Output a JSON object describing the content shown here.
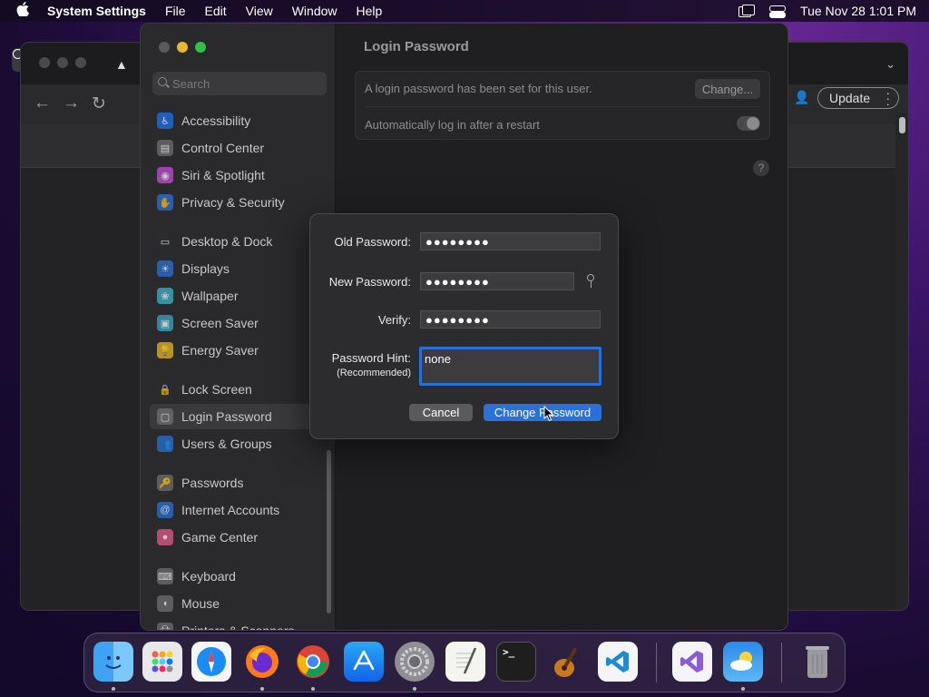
{
  "menubar": {
    "app_name": "System Settings",
    "menus": [
      "File",
      "Edit",
      "View",
      "Window",
      "Help"
    ],
    "clock": "Tue Nov 28  1:01 PM"
  },
  "browser": {
    "update_label": "Update"
  },
  "settings": {
    "search_placeholder": "Search",
    "page_title": "Login Password",
    "password_set_text": "A login password has been set for this user.",
    "change_label": "Change...",
    "auto_login_text": "Automatically log in after a restart",
    "help_label": "?",
    "sidebar_items": [
      {
        "label": "Accessibility",
        "icon": "accessibility-icon",
        "color": "#1a73e8"
      },
      {
        "label": "Control Center",
        "icon": "control-center-icon",
        "color": "#6e6e70"
      },
      {
        "label": "Siri & Spotlight",
        "icon": "siri-icon",
        "color": "#c64bd6"
      },
      {
        "label": "Privacy & Security",
        "icon": "hand-icon",
        "color": "#2a6fd6"
      },
      {
        "label": "Desktop & Dock",
        "icon": "desktop-icon",
        "color": "#2c2c2e"
      },
      {
        "label": "Displays",
        "icon": "displays-icon",
        "color": "#2a6fd6"
      },
      {
        "label": "Wallpaper",
        "icon": "wallpaper-icon",
        "color": "#3bb5c8"
      },
      {
        "label": "Screen Saver",
        "icon": "screen-saver-icon",
        "color": "#3aa7c0"
      },
      {
        "label": "Energy Saver",
        "icon": "energy-icon",
        "color": "#e8b320"
      },
      {
        "label": "Lock Screen",
        "icon": "lock-icon",
        "color": "#2c2c2e"
      },
      {
        "label": "Login Password",
        "icon": "login-password-icon",
        "color": "#6e6e70"
      },
      {
        "label": "Users & Groups",
        "icon": "users-icon",
        "color": "#2a6fd6"
      },
      {
        "label": "Passwords",
        "icon": "key-icon",
        "color": "#6e6e70"
      },
      {
        "label": "Internet Accounts",
        "icon": "at-icon",
        "color": "#2a6fd6"
      },
      {
        "label": "Game Center",
        "icon": "game-center-icon",
        "color": "#e05a8a"
      },
      {
        "label": "Keyboard",
        "icon": "keyboard-icon",
        "color": "#6e6e70"
      },
      {
        "label": "Mouse",
        "icon": "mouse-icon",
        "color": "#6e6e70"
      },
      {
        "label": "Printers & Scanners",
        "icon": "printer-icon",
        "color": "#6e6e70"
      }
    ]
  },
  "dialog": {
    "old_password_label": "Old Password:",
    "old_password_value": "●●●●●●●●",
    "new_password_label": "New Password:",
    "new_password_value": "●●●●●●●●",
    "verify_label": "Verify:",
    "verify_value": "●●●●●●●●",
    "hint_label": "Password Hint:",
    "hint_sublabel": "(Recommended)",
    "hint_value": "none",
    "cancel_label": "Cancel",
    "change_password_label": "Change Password"
  },
  "dock": {
    "apps": [
      "Finder",
      "Launchpad",
      "Safari",
      "Firefox",
      "Chrome",
      "App Store",
      "System Settings",
      "TextEdit",
      "Terminal",
      "GarageBand",
      "VS Code",
      "Visual Studio",
      "Weather",
      "Trash"
    ]
  },
  "colors": {
    "accent": "#2a72d9",
    "dialog_bg": "#2c2c2e",
    "sidebar_bg": "#2a2a2c"
  }
}
